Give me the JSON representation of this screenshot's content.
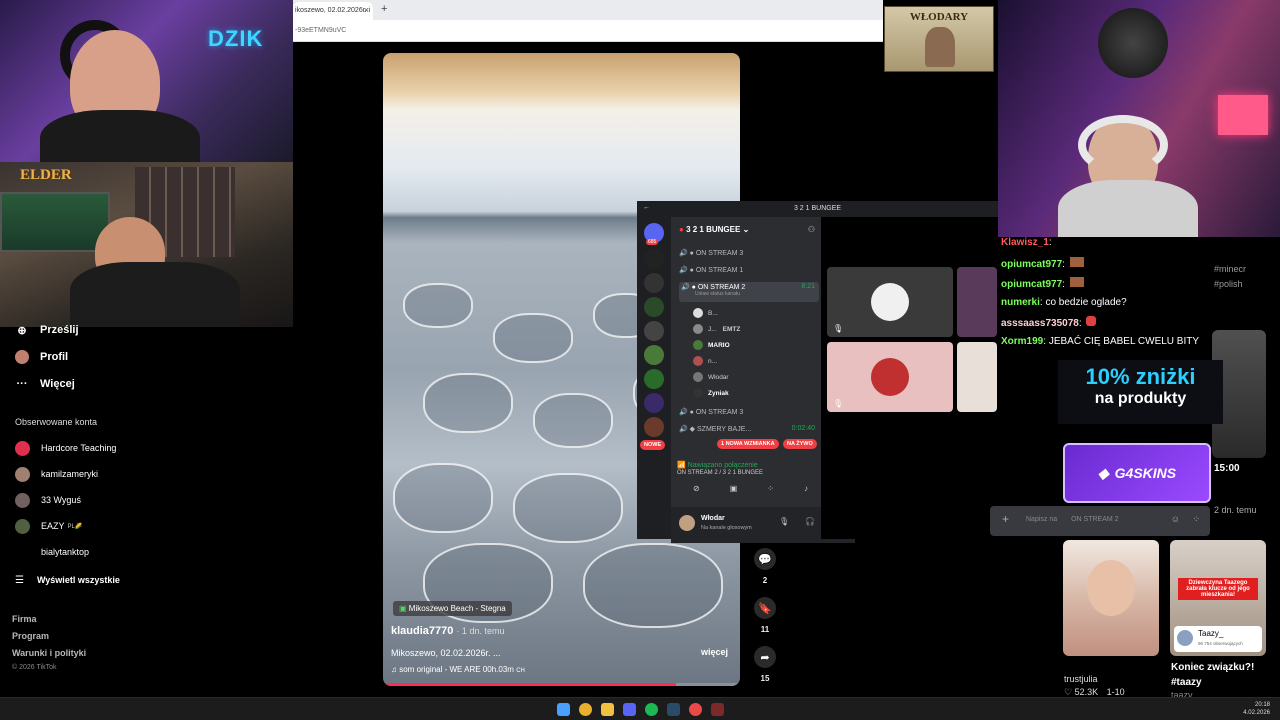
{
  "browser": {
    "tab_title": "ikoszewo, 02.02.2026r. i",
    "tab_close": "×",
    "new_tab": "+",
    "url": "-93eETMN9uVC"
  },
  "streamer_overlays": {
    "dzik_logo": "DZIK",
    "elder_logo": "ELDER",
    "poster_text": "WŁODARY"
  },
  "sidebar": {
    "nav": [
      {
        "label": "Prześlij",
        "icon": "upload-icon"
      },
      {
        "label": "Profil",
        "icon": "profile-avatar"
      },
      {
        "label": "Więcej",
        "icon": "more-icon"
      }
    ],
    "following_title": "Obserwowane konta",
    "accounts": [
      "Hardcore Teaching",
      "kamilzameryki",
      "33 Wyguś",
      "EAZY",
      "bialytanktop"
    ],
    "eazy_suffix": "PL🌽",
    "show_all": "Wyświetl wszystkie",
    "footer": [
      "Firma",
      "Program",
      "Warunki i polityki"
    ],
    "copyright": "© 2026 TikTok"
  },
  "video": {
    "location": "Mikoszewo Beach - Stegna",
    "author": "klaudia7770",
    "posted": "· 1 dn. temu",
    "description": "Mikoszewo, 02.02.2026r. ...",
    "more_label": "więcej",
    "sound": "som original - WE ARE 00h.03m",
    "sound_tag": "CH",
    "progress": 0.82
  },
  "actions": {
    "comments": "2",
    "saves": "11",
    "shares": "15"
  },
  "discord": {
    "window_title": "3 2 1 BUNGEE",
    "server_name": "3 2 1 BUNGEE",
    "server_badge": "685",
    "channels": [
      {
        "name": "ON STREAM 3"
      },
      {
        "name": "ON STREAM 1"
      },
      {
        "name": "ON STREAM 2",
        "time": "8:21",
        "status": "Ustaw status kanału"
      }
    ],
    "voice_users": [
      "B...",
      "J...",
      "MARIO",
      "n...",
      "Włodar",
      "Zyniak"
    ],
    "eazy_tag": "EMTZ",
    "channels_after": [
      {
        "name": "ON STREAM 3"
      },
      {
        "name": "SZMERY BAJE...",
        "time": "0:02:40"
      }
    ],
    "new_pill": "NOWE",
    "mention_pill": "1 NOWA WZMIANKA",
    "live_pill": "NA ŻYWO",
    "voice_connected": "Nawiązano połączenie",
    "voice_channel": "ON STREAM 2 / 3 2 1 BUNGEE",
    "user_name": "Włodar",
    "user_status": "Na kanale głosowym",
    "chat_placeholder": "Napisz na",
    "chat_channel": "ON STREAM 2"
  },
  "chat": [
    {
      "nick": "Klawisz_1",
      "text": ""
    },
    {
      "nick": "opiumcat977",
      "text": ""
    },
    {
      "nick": "opiumcat977",
      "text": ""
    },
    {
      "nick": "numerki",
      "text": "co bedzie oglade?"
    },
    {
      "nick": "asssaass735078",
      "text": ""
    },
    {
      "nick": "Xorm199",
      "text": "JEBAĆ CIĘ BABEL CWELU BITY"
    }
  ],
  "promo": {
    "discount": "10% zniżki",
    "products": "na produkty",
    "brand": "G4SKINS"
  },
  "feed": {
    "tag1": "#minecr",
    "tag2": "#polish",
    "time": "15:00",
    "age": "2 dn. temu",
    "card_caption": "Dziewczyna Taazego zabrała klucze od jego mieszkania!",
    "card_handle": "Taazy_",
    "card_followers": "96 754 obserwujących",
    "left_user": "trustjulia",
    "left_likes": "52.3K",
    "left_age": "1-10",
    "right_title": "Koniec związku?!",
    "right_tag": "#taazy",
    "right_author": "taazy"
  },
  "taskbar": {
    "time": "20:18",
    "date": "4.02.2026"
  },
  "colors": {
    "tiktok_red": "#fe2c55",
    "discord_bg": "#313338",
    "chat_nick": "#7dff5a",
    "promo_cyan": "#2ad0ff",
    "g4_purple": "#7a3ae0"
  }
}
